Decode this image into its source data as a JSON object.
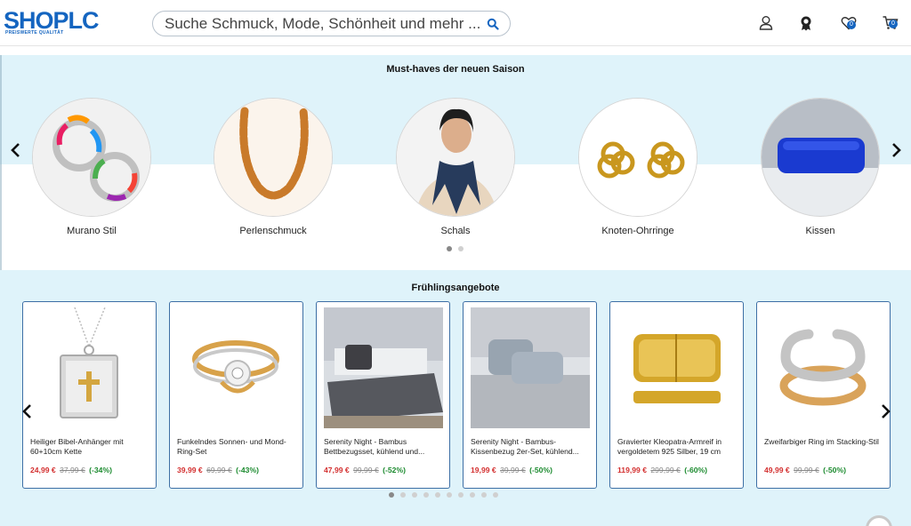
{
  "header": {
    "logo_text": "SHOPLC",
    "logo_tagline": "PREISWERTE QUALITÄT",
    "search_placeholder": "Suche Schmuck, Mode, Schönheit und mehr ...",
    "wishlist_count": "0",
    "cart_count": "0",
    "icons": [
      "user-icon",
      "award-icon",
      "wishlist-heart-icon",
      "cart-icon"
    ]
  },
  "categories": {
    "title": "Must-haves der neuen Saison",
    "items": [
      {
        "label": "Murano Stil",
        "icon": "murano-earrings-image"
      },
      {
        "label": "Perlenschmuck",
        "icon": "amber-necklace-image"
      },
      {
        "label": "Schals",
        "icon": "scarf-model-image"
      },
      {
        "label": "Knoten-Ohrringe",
        "icon": "knot-earrings-image"
      },
      {
        "label": "Kissen",
        "icon": "pillow-image"
      }
    ],
    "page_dots": 2,
    "active_dot": 0
  },
  "offers": {
    "title": "Frühlingsangebote",
    "products": [
      {
        "title": "Heiliger Bibel-Anhänger mit 60+10cm Kette",
        "price": "24,99 €",
        "old_price": "37,99 €",
        "discount": "(-34%)"
      },
      {
        "title": "Funkelndes Sonnen- und Mond-Ring-Set",
        "price": "39,99 €",
        "old_price": "69,99 €",
        "discount": "(-43%)"
      },
      {
        "title": "Serenity Night - Bambus Bettbezugsset, kühlend und...",
        "price": "47,99 €",
        "old_price": "99,99 €",
        "discount": "(-52%)"
      },
      {
        "title": "Serenity Night - Bambus-Kissenbezug 2er-Set, kühlend...",
        "price": "19,99 €",
        "old_price": "39,99 €",
        "discount": "(-50%)"
      },
      {
        "title": "Gravierter Kleopatra-Armreif in vergoldetem 925 Silber, 19 cm",
        "price": "119,99 €",
        "old_price": "299,99 €",
        "discount": "(-60%)"
      },
      {
        "title": "Zweifarbiger Ring im Stacking-Stil",
        "price": "49,99 €",
        "old_price": "99,99 €",
        "discount": "(-50%)"
      }
    ],
    "page_dots": 10,
    "active_dot": 0
  },
  "colors": {
    "brand": "#1565c0",
    "section_bg": "#dff3fa",
    "price": "#d32f2f",
    "discount": "#1b8a2e"
  }
}
